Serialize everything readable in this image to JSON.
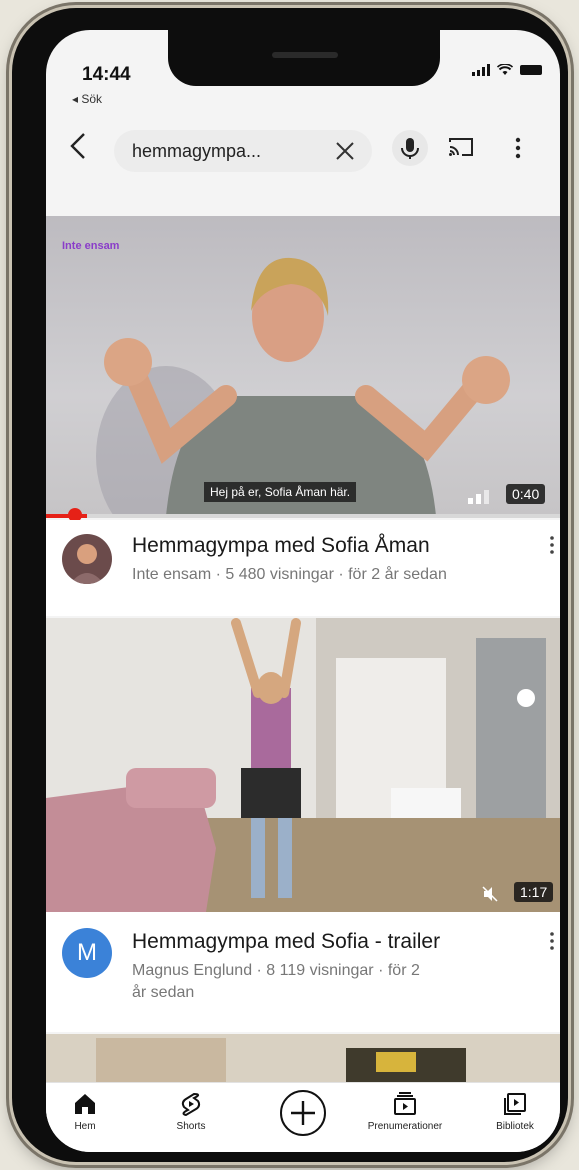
{
  "status": {
    "time": "14:44",
    "back_app": "◂ Sök"
  },
  "search": {
    "query": "hemmagympa..."
  },
  "videos": [
    {
      "title": "Hemmagympa med Sofia Åman",
      "meta": "Inte ensam · 5 480 visningar · för 2 år sedan",
      "duration": "0:40",
      "subtitle": "Hej på er, Sofia Åman här.",
      "channel_logo": "Inte ensam"
    },
    {
      "title": "Hemmagympa med Sofia - trailer",
      "meta": "Magnus Englund · 8 119 visningar · för 2 år sedan",
      "duration": "1:17",
      "avatar_letter": "M"
    }
  ],
  "nav": {
    "home": "Hem",
    "shorts": "Shorts",
    "subscriptions": "Prenumerationer",
    "library": "Bibliotek"
  },
  "colors": {
    "brand_red": "#e62117",
    "avatar_blue": "#3b82d8"
  }
}
